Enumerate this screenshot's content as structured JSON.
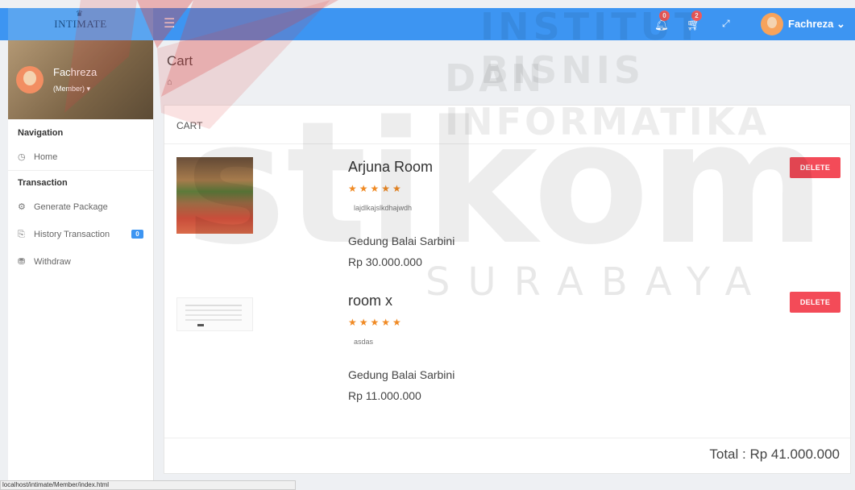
{
  "header": {
    "logo": "INTIMATE",
    "menu_icon": "menu-icon",
    "notification_count": "0",
    "cart_count": "2",
    "user_name": "Fachreza ⌄"
  },
  "sidebar": {
    "profile_name": "Fachreza",
    "profile_role": "(Member) ▾",
    "nav_heading": "Navigation",
    "home_label": "Home",
    "transaction_heading": "Transaction",
    "items": [
      {
        "label": "Generate Package",
        "icon": "package-icon"
      },
      {
        "label": "History Transaction",
        "icon": "history-icon",
        "badge": "0"
      },
      {
        "label": "Withdraw",
        "icon": "withdraw-icon"
      }
    ]
  },
  "page": {
    "title": "Cart",
    "breadcrumb_icon": "home-icon"
  },
  "cart": {
    "header": "CART",
    "items": [
      {
        "name": "Arjuna Room",
        "stars": "★★★★★",
        "description": "lajdlkajslkdhajwdh",
        "venue": "Gedung Balai Sarbini",
        "price": "Rp 30.000.000",
        "delete_label": "DELETE"
      },
      {
        "name": "room x",
        "stars": "★★★★★",
        "description": "asdas",
        "venue": "Gedung Balai Sarbini",
        "price": "Rp 11.000.000",
        "delete_label": "DELETE"
      }
    ],
    "total": "Total : Rp 41.000.000"
  },
  "statusbar": {
    "url": "localhost/intimate/Member/index.html"
  },
  "watermark": {
    "line1": "INSTITUT BISNIS",
    "line2": "DAN INFORMATIKA",
    "line3": "SURABAYA",
    "logo_text": "stikom"
  },
  "colors": {
    "topbar": "#3d95f2",
    "delete_button": "#f34b58",
    "stars": "#f08a24"
  }
}
